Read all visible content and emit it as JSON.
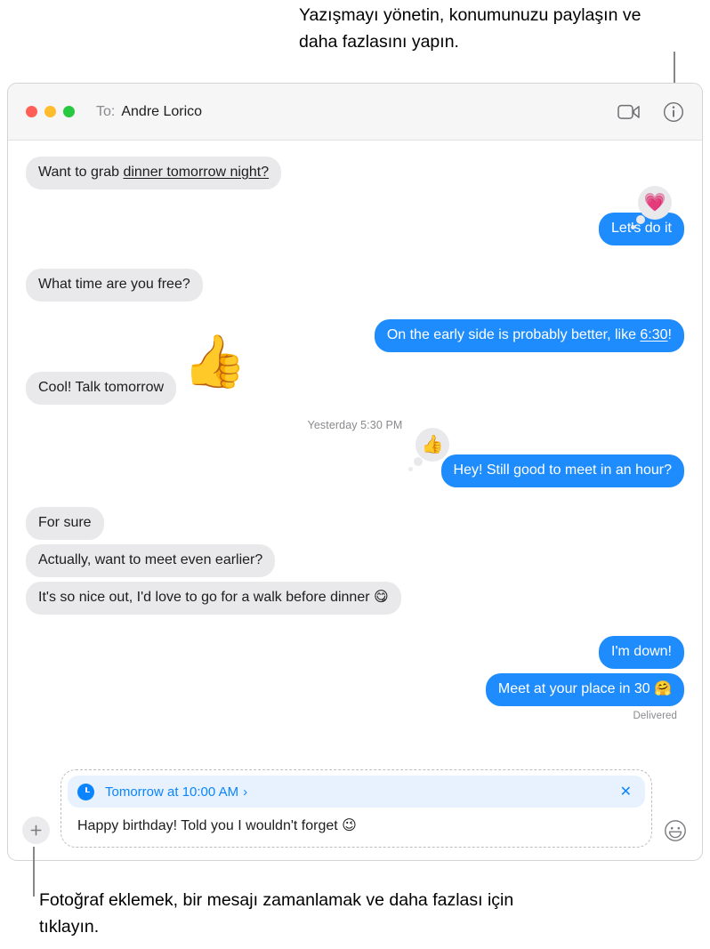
{
  "callouts": {
    "top": "Yazışmayı yönetin, konumunuzu paylaşın ve daha fazlasını yapın.",
    "bottom": "Fotoğraf eklemek, bir mesajı zamanlamak ve daha fazlası için tıklayın."
  },
  "window": {
    "titlebar": {
      "to_label": "To:",
      "recipient": "Andre Lorico",
      "facetime_icon": "video-camera-icon",
      "info_icon": "info-circle-icon",
      "traffic_lights": {
        "close": "close-button",
        "minimize": "minimize-button",
        "zoom": "zoom-button"
      }
    }
  },
  "conversation": {
    "messages": [
      {
        "id": "m1",
        "side": "them",
        "text_before": "Want to grab ",
        "text_link": "dinner tomorrow night?",
        "text_after": "",
        "tail": true
      },
      {
        "id": "m2",
        "side": "me",
        "text": "Let's do it",
        "tail": true,
        "tapback": "💗"
      },
      {
        "id": "m3",
        "side": "them",
        "text": "What time are you free?",
        "tail": true
      },
      {
        "id": "m4",
        "side": "me",
        "text_before": "On the early side is probably better, like ",
        "text_link": "6:30",
        "text_after": "!",
        "tail": true
      },
      {
        "id": "m5",
        "side": "them",
        "text": "Cool! Talk tomorrow",
        "tail": true,
        "sticker": "👍"
      }
    ],
    "timestamp": "Yesterday 5:30 PM",
    "messages2": [
      {
        "id": "m6",
        "side": "me",
        "text": "Hey! Still good to meet in an hour?",
        "tail": true,
        "tapback": "👍"
      },
      {
        "id": "m7",
        "side": "them",
        "text": "For sure",
        "tail": false
      },
      {
        "id": "m8",
        "side": "them",
        "text": "Actually, want to meet even earlier?",
        "tail": false
      },
      {
        "id": "m9",
        "side": "them",
        "text": "It's so nice out, I'd love to go for a walk before dinner 😋",
        "tail": true
      },
      {
        "id": "m10",
        "side": "me",
        "text": "I'm down!",
        "tail": false
      },
      {
        "id": "m11",
        "side": "me",
        "text": "Meet at your place in 30 🤗",
        "tail": true
      }
    ],
    "status": "Delivered"
  },
  "composer": {
    "add_button_icon": "plus-icon",
    "scheduled": {
      "clock_icon": "clock-icon",
      "label": "Tomorrow at 10:00 AM",
      "chevron": "›",
      "close_label": "✕"
    },
    "draft_text": "Happy birthday! Told you I wouldn't forget 😉",
    "emoji_button_icon": "smiley-face-icon"
  },
  "colors": {
    "me_bubble": "#1f8cfd",
    "them_bubble": "#e9e9eb",
    "accent_blue": "#0a84ff",
    "chip_background": "#e7f2fe",
    "titlebar": "#f6f6f6"
  }
}
